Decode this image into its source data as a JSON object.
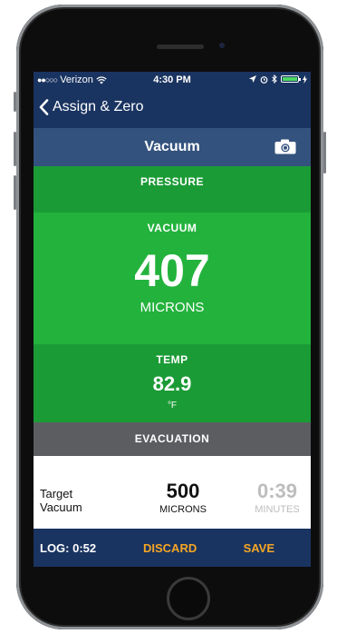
{
  "status_bar": {
    "carrier": "Verizon",
    "time": "4:30 PM",
    "signal_dots": "●●○○○",
    "wifi_icon": "wifi-icon",
    "location_icon": "location-arrow-icon",
    "alarm_icon": "alarm-icon",
    "bluetooth_icon": "bluetooth-icon",
    "battery_color": "#4cd964"
  },
  "nav": {
    "back_label": "Assign & Zero",
    "back_icon": "chevron-left-icon"
  },
  "header": {
    "title": "Vacuum",
    "camera_icon": "camera-icon"
  },
  "pressure": {
    "label": "PRESSURE"
  },
  "vacuum": {
    "label": "VACUUM",
    "value": "407",
    "unit": "MICRONS"
  },
  "temp": {
    "label": "TEMP",
    "value": "82.9",
    "unit": "°F"
  },
  "evacuation": {
    "label": "EVACUATION",
    "target_label": "Target Vacuum",
    "target_value": "500",
    "target_unit": "MICRONS",
    "timer_value": "0:39",
    "timer_unit": "MINUTES"
  },
  "footer": {
    "log": "LOG: 0:52",
    "discard": "DISCARD",
    "save": "SAVE"
  },
  "colors": {
    "navy": "#1a3461",
    "header_blue": "#33527d",
    "green_dark": "#1b9b36",
    "green_bright": "#23b33d",
    "gray": "#5c5d61",
    "accent_orange": "#f5a623"
  }
}
